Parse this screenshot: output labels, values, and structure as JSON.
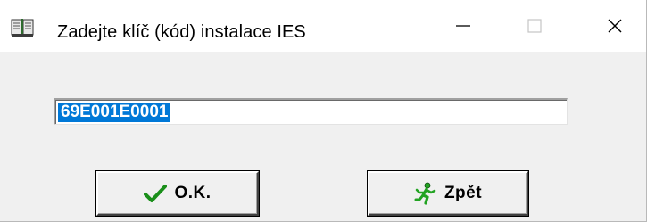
{
  "window": {
    "title": "Zadejte klíč (kód) instalace IES",
    "icon": "book-icon",
    "controls": [
      "minimize-icon",
      "maximize-icon",
      "close-icon"
    ]
  },
  "install_key": {
    "value": "69E001E0001",
    "selected": true
  },
  "buttons": {
    "ok_label": "O.K.",
    "ok_icon": "checkmark-icon",
    "back_label": "Zpět",
    "back_icon": "running-man-icon"
  },
  "colors": {
    "selection": "#0078d7",
    "checkmark": "#1a8f1a",
    "runner": "#22a322"
  }
}
